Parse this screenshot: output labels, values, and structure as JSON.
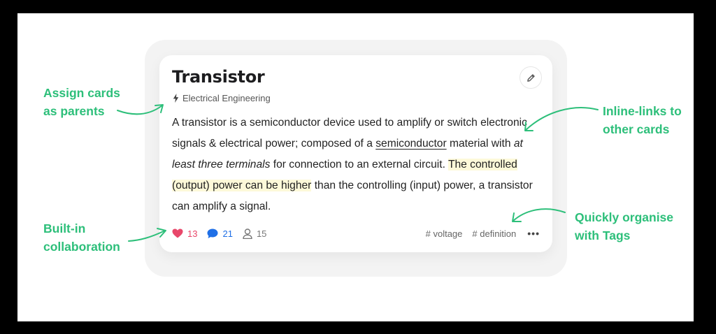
{
  "card": {
    "title": "Transistor",
    "parent": "Electrical Engineering",
    "body": {
      "p1": "A transistor is a semiconductor device used to amplify or switch electronic signals & electrical power; composed of a ",
      "link": "semiconductor",
      "p2": " material with ",
      "italic": "at least three terminals",
      "p3": " for connection to an external circuit. ",
      "highlight": "The controlled (output) power can be higher",
      "p4": " than the controlling (input) power, a transistor can amplify a signal."
    },
    "likes": "13",
    "comments": "21",
    "collaborators": "15",
    "tags": [
      "# voltage",
      "# definition"
    ],
    "more": "•••"
  },
  "annotations": {
    "parents": [
      "Assign cards",
      "as parents"
    ],
    "inline": [
      "Inline-links to",
      "other cards"
    ],
    "collab": [
      "Built-in",
      "collaboration"
    ],
    "tags": [
      "Quickly organise",
      "with Tags"
    ]
  },
  "colors": {
    "accent": "#2dbf7a",
    "like": "#e8476a",
    "comment": "#1f6fe6",
    "highlight": "#fdf9d9"
  },
  "icons": {
    "edit": "pencil-icon",
    "parent": "lightning-bolt-icon",
    "likes": "heart-icon",
    "comments": "chat-bubble-icon",
    "collaborators": "person-icon"
  }
}
